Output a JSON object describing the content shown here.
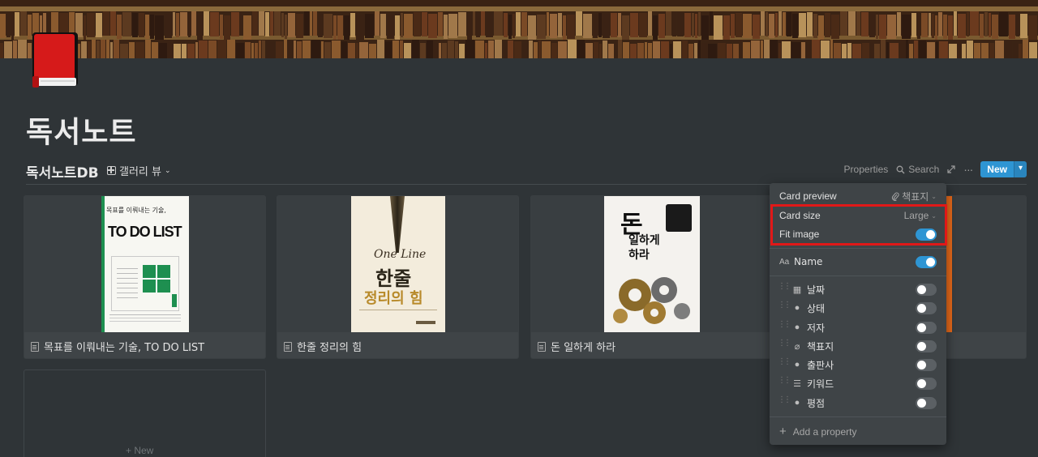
{
  "page": {
    "title": "독서노트",
    "icon": "red-book-icon"
  },
  "database": {
    "title": "독서노트DB",
    "view_label": "갤러리 뷰",
    "toolbar": {
      "properties": "Properties",
      "search": "Search",
      "new": "New"
    }
  },
  "cards": [
    {
      "name": "목표를 이뤄내는 기술, TO DO LIST",
      "cover": {
        "top": "목표를 이뤄내는 기술,",
        "title": "TO DO LIST"
      }
    },
    {
      "name": "한줄 정리의 힘",
      "cover": {
        "script": "One Line",
        "title": "한줄",
        "subtitle": "정리의 힘"
      }
    },
    {
      "name": "돈 일하게 하라",
      "cover": {
        "title": "돈",
        "subtitle": "일하게 하라"
      }
    }
  ],
  "empty_card": {
    "add_label": "+ New"
  },
  "panel": {
    "card_preview": {
      "label": "Card preview",
      "value": "책표지"
    },
    "card_size": {
      "label": "Card size",
      "value": "Large"
    },
    "fit_image": {
      "label": "Fit image",
      "on": true
    },
    "name_prop": {
      "label": "Name",
      "on": true
    },
    "properties": [
      {
        "label": "날짜",
        "icon": "calendar-icon",
        "on": false
      },
      {
        "label": "상태",
        "icon": "select-icon",
        "on": false
      },
      {
        "label": "저자",
        "icon": "select-icon",
        "on": false
      },
      {
        "label": "책표지",
        "icon": "paperclip-icon",
        "on": false
      },
      {
        "label": "출판사",
        "icon": "select-icon",
        "on": false
      },
      {
        "label": "키워드",
        "icon": "list-icon",
        "on": false
      },
      {
        "label": "평점",
        "icon": "select-icon",
        "on": false
      }
    ],
    "add_property": "Add a property"
  },
  "colors": {
    "background": "#2f3437",
    "accent": "#2e95d3",
    "highlight": "#e11818"
  }
}
